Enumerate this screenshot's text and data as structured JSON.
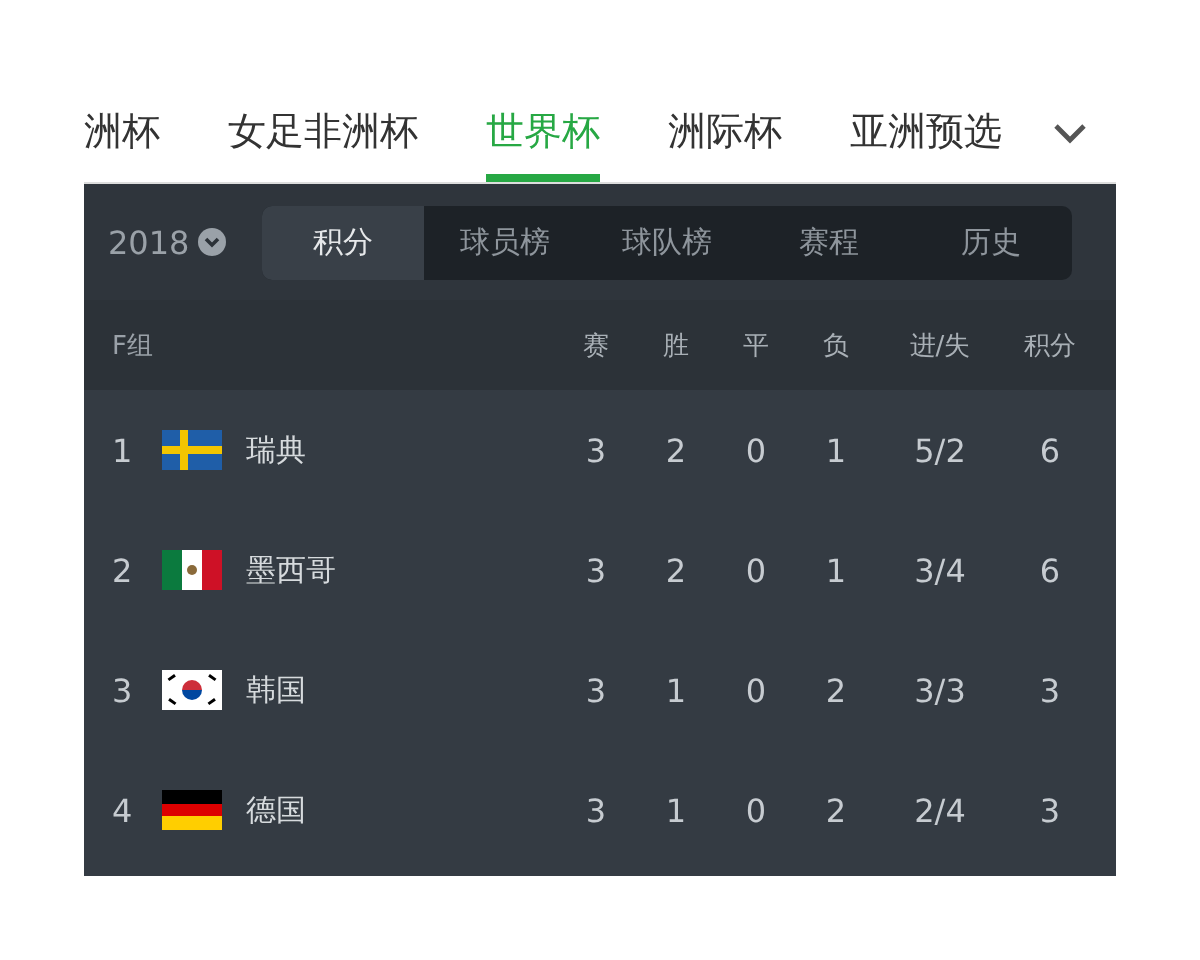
{
  "tabs": [
    {
      "label": "洲杯",
      "selected": false
    },
    {
      "label": "女足非洲杯",
      "selected": false
    },
    {
      "label": "世界杯",
      "selected": true
    },
    {
      "label": "洲际杯",
      "selected": false
    },
    {
      "label": "亚洲预选",
      "selected": false
    }
  ],
  "year": "2018",
  "segments": [
    {
      "label": "积分",
      "selected": true
    },
    {
      "label": "球员榜",
      "selected": false
    },
    {
      "label": "球队榜",
      "selected": false
    },
    {
      "label": "赛程",
      "selected": false
    },
    {
      "label": "历史",
      "selected": false
    }
  ],
  "table": {
    "group": "F组",
    "columns": [
      "赛",
      "胜",
      "平",
      "负",
      "进/失",
      "积分"
    ],
    "rows": [
      {
        "rank": "1",
        "kind": "sweden",
        "team": "瑞典",
        "cells": [
          "3",
          "2",
          "0",
          "1",
          "5/2",
          "6"
        ]
      },
      {
        "rank": "2",
        "kind": "mexico",
        "team": "墨西哥",
        "cells": [
          "3",
          "2",
          "0",
          "1",
          "3/4",
          "6"
        ]
      },
      {
        "rank": "3",
        "kind": "korea",
        "team": "韩国",
        "cells": [
          "3",
          "1",
          "0",
          "2",
          "3/3",
          "3"
        ]
      },
      {
        "rank": "4",
        "kind": "germany",
        "team": "德国",
        "cells": [
          "3",
          "1",
          "0",
          "2",
          "2/4",
          "3"
        ]
      }
    ]
  }
}
